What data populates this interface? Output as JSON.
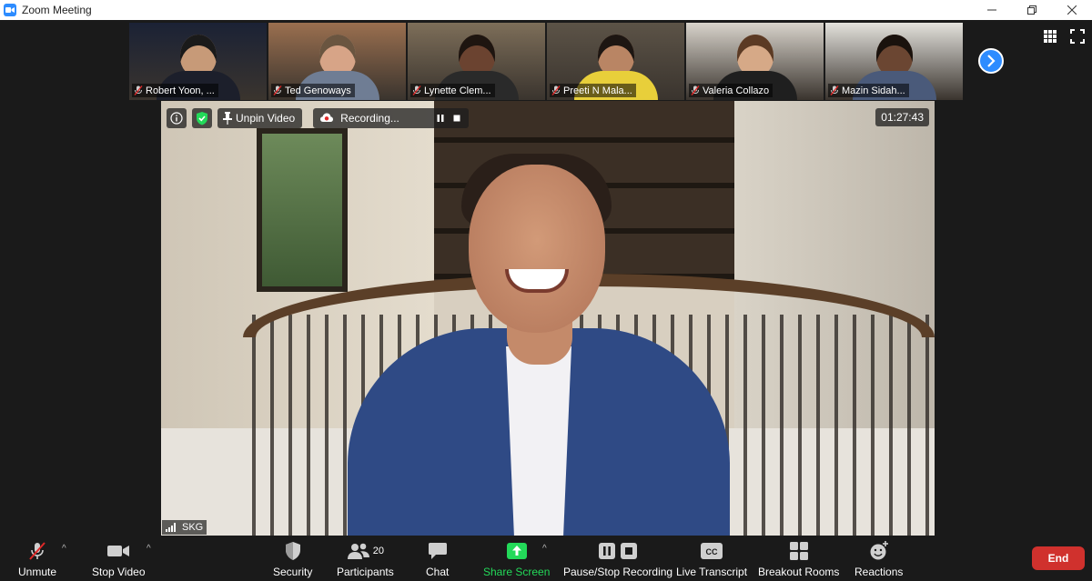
{
  "window": {
    "title": "Zoom Meeting",
    "controls": [
      "minimize",
      "restore",
      "close"
    ]
  },
  "gallery": {
    "participants": [
      {
        "name": "Robert Yoon, ...",
        "muted": true,
        "bg": "#1b2235",
        "skin": "#c79a78",
        "shirt": "#1c1f2b",
        "hair": "#1a1a1a"
      },
      {
        "name": "Ted Genoways",
        "muted": true,
        "bg": "#9a6f4f",
        "skin": "#d7a487",
        "shirt": "#6f7d94",
        "hair": "#6a5540"
      },
      {
        "name": "Lynette Clem...",
        "muted": true,
        "bg": "#7d6e59",
        "skin": "#6b4330",
        "shirt": "#2a2a2a",
        "hair": "#1e1510"
      },
      {
        "name": "Preeti N Mala...",
        "muted": true,
        "bg": "#5c5347",
        "skin": "#b98564",
        "shirt": "#e8cf3a",
        "hair": "#1d1612"
      },
      {
        "name": "Valeria Collazo",
        "muted": true,
        "bg": "#d8d3cb",
        "skin": "#d6a987",
        "shirt": "#1f1f1f",
        "hair": "#5b3a24"
      },
      {
        "name": "Mazin Sidah...",
        "muted": true,
        "bg": "#e3e1dc",
        "skin": "#6b4632",
        "shirt": "#4a5a7a",
        "hair": "#1a120d"
      }
    ]
  },
  "main_video": {
    "speaker": "SKG",
    "buttons": {
      "unpin": "Unpin Video",
      "recording": "Recording..."
    },
    "timer": "01:27:43"
  },
  "toolbar": {
    "unmute": "Unmute",
    "stop_video": "Stop Video",
    "security": "Security",
    "participants": "Participants",
    "participants_count": "20",
    "chat": "Chat",
    "share_screen": "Share Screen",
    "recording": "Pause/Stop Recording",
    "live_transcript": "Live Transcript",
    "live_transcript_icon_text": "CC",
    "breakout_rooms": "Breakout Rooms",
    "reactions": "Reactions",
    "end": "End"
  },
  "colors": {
    "accent": "#2d8cff",
    "share_green": "#23d959",
    "end_red": "#d0312d",
    "mute_red": "#e02828",
    "background": "#1a1a1a"
  }
}
